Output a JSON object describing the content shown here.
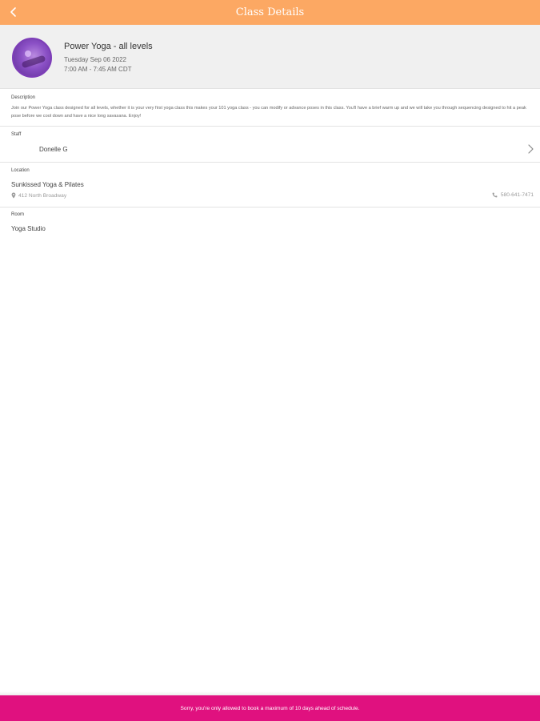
{
  "header": {
    "title": "Class Details",
    "back_icon": "chevron-left-icon",
    "background": "#fca863"
  },
  "class": {
    "name": "Power Yoga - all levels",
    "date": "Tuesday Sep 06 2022",
    "time": "7:00 AM - 7:45 AM CDT"
  },
  "description": {
    "label": "Description",
    "text": "Join our Power Yoga class designed for all levels, whether it is your very first yoga class this makes your 101 yoga class - you can modify or advance poses in this class. You'll have a brief warm up and we will take you through sequencing designed to hit a peak pose before we cool down and have a nice long savasana. Enjoy!"
  },
  "staff": {
    "label": "Staff",
    "name": "Donelle G"
  },
  "location": {
    "label": "Location",
    "name": "Sunkissed Yoga & Pilates",
    "address": "412 North Broadway",
    "phone": "580-641-7471"
  },
  "room": {
    "label": "Room",
    "name": "Yoga Studio"
  },
  "toast": {
    "message": "Sorry, you're only allowed to book a maximum of 10 days ahead of schedule.",
    "background": "#e0117f"
  }
}
